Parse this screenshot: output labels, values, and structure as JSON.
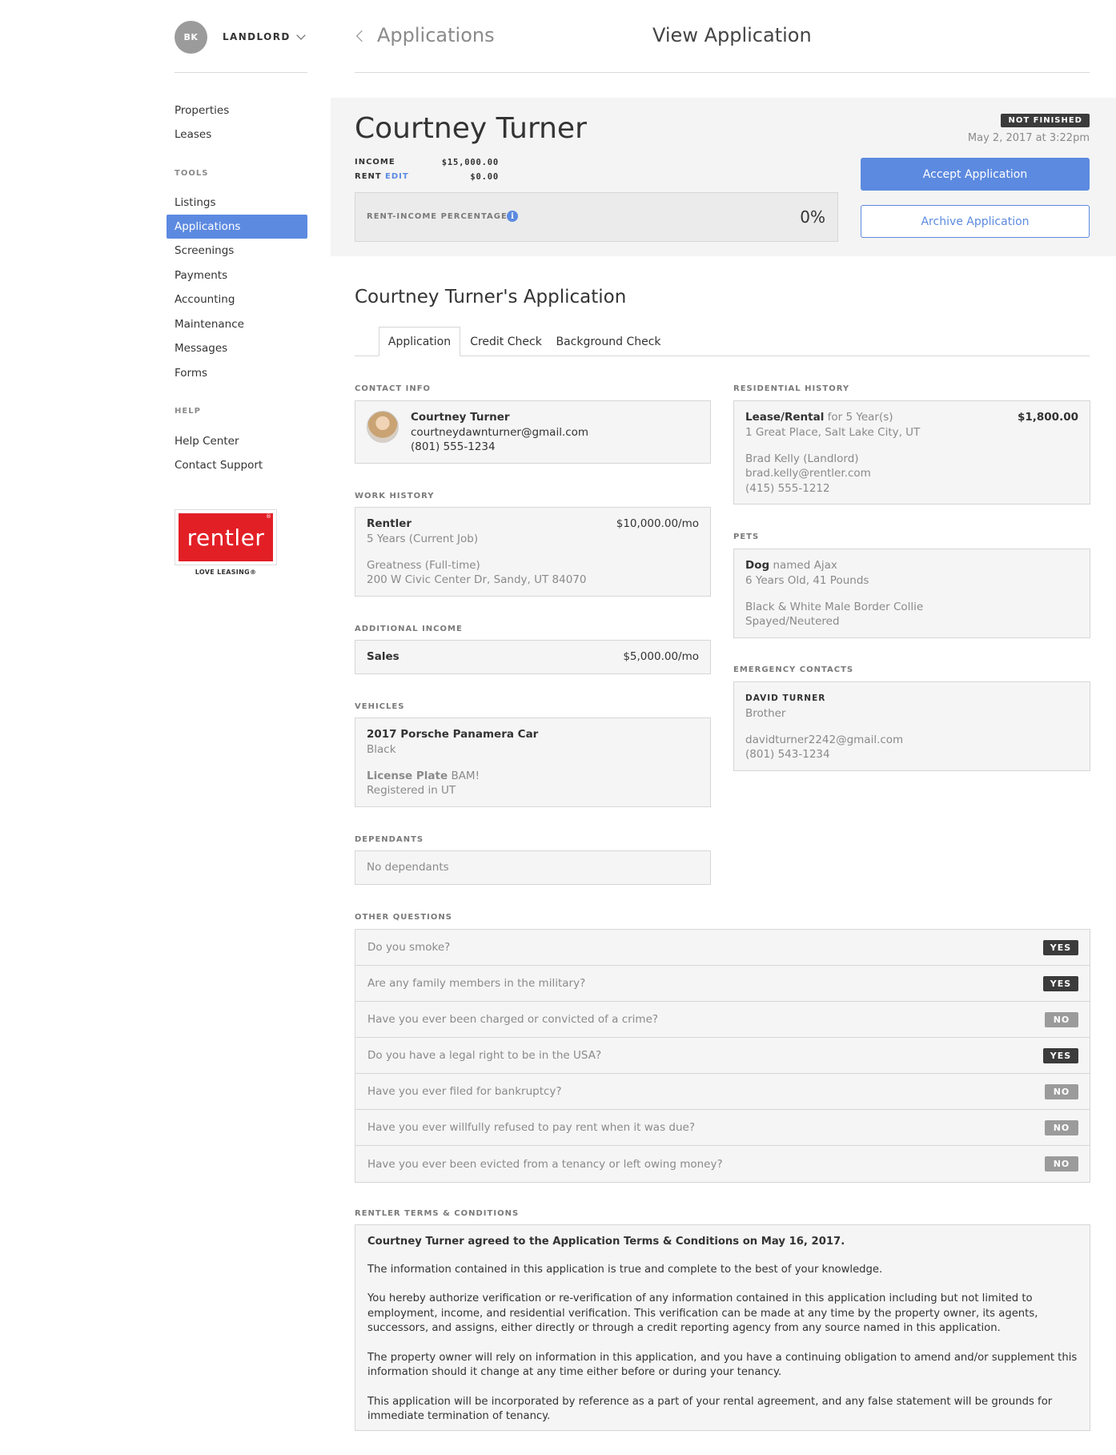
{
  "account": {
    "initials": "BK",
    "role": "LANDLORD"
  },
  "nav": {
    "top": [
      "Properties",
      "Leases"
    ],
    "tools_heading": "TOOLS",
    "tools": [
      "Listings",
      "Applications",
      "Screenings",
      "Payments",
      "Accounting",
      "Maintenance",
      "Messages",
      "Forms"
    ],
    "help_heading": "HELP",
    "help": [
      "Help Center",
      "Contact Support"
    ],
    "active": "Applications"
  },
  "logo": {
    "text": "rentler",
    "tagline": "LOVE LEASING®",
    "brand_color": "#e31f26"
  },
  "topbar": {
    "back_label": "Applications",
    "title": "View Application"
  },
  "header": {
    "name": "Courtney Turner",
    "income_label": "INCOME",
    "income_value": "$15,000.00",
    "rent_label": "RENT",
    "rent_edit": "EDIT",
    "rent_value": "$0.00",
    "ratio_label": "RENT-INCOME PERCENTAGE",
    "ratio_value": "0%",
    "status": "NOT FINISHED",
    "date": "May 2, 2017 at 3:22pm",
    "accept_label": "Accept Application",
    "archive_label": "Archive Application",
    "accent_color": "#5c8ae0"
  },
  "application": {
    "title": "Courtney Turner's Application",
    "tabs": [
      "Application",
      "Credit Check",
      "Background Check"
    ],
    "active_tab": "Application"
  },
  "contact": {
    "label": "CONTACT INFO",
    "name": "Courtney Turner",
    "email": "courtneydawnturner@gmail.com",
    "phone": "(801) 555-1234"
  },
  "work": {
    "label": "WORK HISTORY",
    "employer": "Rentler",
    "duration": "5 Years (Current Job)",
    "income": "$10,000.00/mo",
    "position": "Greatness (Full-time)",
    "address": "200 W Civic Center Dr, Sandy, UT 84070"
  },
  "additional_income": {
    "label": "ADDITIONAL INCOME",
    "source": "Sales",
    "amount": "$5,000.00/mo"
  },
  "vehicles": {
    "label": "VEHICLES",
    "name": "2017 Porsche Panamera Car",
    "color": "Black",
    "plate_label": "License Plate",
    "plate_value": "BAM!",
    "registered": "Registered in UT"
  },
  "dependants": {
    "label": "DEPENDANTS",
    "text": "No dependants"
  },
  "residential": {
    "label": "RESIDENTIAL HISTORY",
    "type": "Lease/Rental",
    "duration": "for 5 Year(s)",
    "rent": "$1,800.00",
    "address": "1 Great Place, Salt Lake City, UT",
    "landlord": "Brad Kelly (Landlord)",
    "landlord_email": "brad.kelly@rentler.com",
    "landlord_phone": "(415) 555-1212"
  },
  "pets": {
    "label": "PETS",
    "kind": "Dog",
    "name": "named Ajax",
    "age_weight": "6 Years Old, 41 Pounds",
    "description": "Black & White Male Border Collie",
    "status": "Spayed/Neutered"
  },
  "emergency": {
    "label": "EMERGENCY CONTACTS",
    "name": "DAVID TURNER",
    "relation": "Brother",
    "email": "davidturner2242@gmail.com",
    "phone": "(801) 543-1234"
  },
  "questions": {
    "label": "OTHER QUESTIONS",
    "items": [
      {
        "q": "Do you smoke?",
        "a": "YES"
      },
      {
        "q": "Are any family members in the military?",
        "a": "YES"
      },
      {
        "q": "Have you ever been charged or convicted of a crime?",
        "a": "NO"
      },
      {
        "q": "Do you have a legal right to be in the USA?",
        "a": "YES"
      },
      {
        "q": "Have you ever filed for bankruptcy?",
        "a": "NO"
      },
      {
        "q": "Have you ever willfully refused to pay rent when it was due?",
        "a": "NO"
      },
      {
        "q": "Have you ever been evicted from a tenancy or left owing money?",
        "a": "NO"
      }
    ]
  },
  "terms": {
    "label": "RENTLER TERMS & CONDITIONS",
    "agreed": "Courtney Turner agreed to the Application Terms & Conditions on May 16, 2017.",
    "p1": "The information contained in this application is true and complete to the best of your knowledge.",
    "p2": "You hereby authorize verification or re-verification of any information contained in this application including but not limited to employment, income, and residential verification. This verification can be made at any time by the property owner, its agents, successors, and assigns, either directly or through a credit reporting agency from any source named in this application.",
    "p3": "The property owner will rely on information in this application, and you have a continuing obligation to amend and/or supplement this information should it change at any time either before or during your tenancy.",
    "p4": "This application will be incorporated by reference as a part of your rental agreement, and any false statement will be grounds for immediate termination of tenancy."
  }
}
